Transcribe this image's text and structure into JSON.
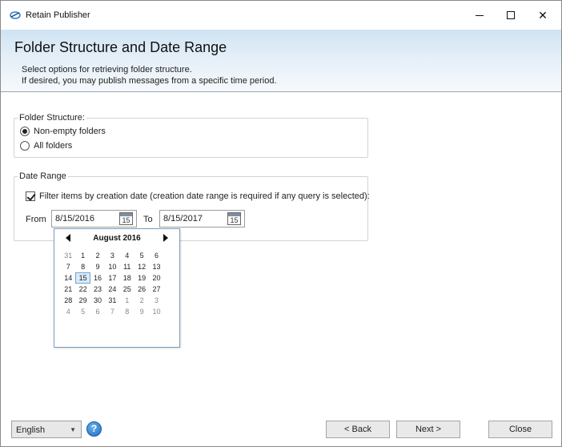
{
  "window": {
    "title": "Retain Publisher",
    "minimize_glyph": "—",
    "close_glyph": "✕"
  },
  "header": {
    "title": "Folder Structure and Date Range",
    "line1": "Select options for retrieving folder structure.",
    "line2": "If desired, you may publish messages from a specific time period."
  },
  "folder_structure": {
    "label": "Folder Structure:",
    "options": [
      {
        "label": "Non-empty folders",
        "selected": true
      },
      {
        "label": "All folders",
        "selected": false
      }
    ]
  },
  "date_range": {
    "label": "Date Range",
    "filter_label": "Filter items by creation date (creation date range is required if any query is selected):",
    "filter_checked": true,
    "from_label": "From",
    "from_value": "8/15/2016",
    "to_label": "To",
    "to_value": "8/15/2017",
    "calendar_icon_day": "15"
  },
  "calendar": {
    "month": "August 2016",
    "days": [
      {
        "d": "31",
        "other": true
      },
      {
        "d": "1"
      },
      {
        "d": "2"
      },
      {
        "d": "3"
      },
      {
        "d": "4"
      },
      {
        "d": "5"
      },
      {
        "d": "6"
      },
      {
        "d": "7"
      },
      {
        "d": "8"
      },
      {
        "d": "9"
      },
      {
        "d": "10"
      },
      {
        "d": "11"
      },
      {
        "d": "12"
      },
      {
        "d": "13"
      },
      {
        "d": "14"
      },
      {
        "d": "15",
        "sel": true
      },
      {
        "d": "16"
      },
      {
        "d": "17"
      },
      {
        "d": "18"
      },
      {
        "d": "19"
      },
      {
        "d": "20"
      },
      {
        "d": "21"
      },
      {
        "d": "22"
      },
      {
        "d": "23"
      },
      {
        "d": "24"
      },
      {
        "d": "25"
      },
      {
        "d": "26"
      },
      {
        "d": "27"
      },
      {
        "d": "28"
      },
      {
        "d": "29"
      },
      {
        "d": "30"
      },
      {
        "d": "31"
      },
      {
        "d": "1",
        "other": true
      },
      {
        "d": "2",
        "other": true
      },
      {
        "d": "3",
        "other": true
      },
      {
        "d": "4",
        "other": true
      },
      {
        "d": "5",
        "other": true
      },
      {
        "d": "6",
        "other": true
      },
      {
        "d": "7",
        "other": true
      },
      {
        "d": "8",
        "other": true
      },
      {
        "d": "9",
        "other": true
      },
      {
        "d": "10",
        "other": true
      }
    ]
  },
  "footer": {
    "language": "English",
    "help_glyph": "?",
    "back_label": "< Back",
    "next_label": "Next >",
    "close_label": "Close"
  },
  "colors": {
    "header_gradient_top": "#cfe3f3",
    "selected_day_bg": "#dbeaf7",
    "help_blue": "#1e6fc0"
  }
}
